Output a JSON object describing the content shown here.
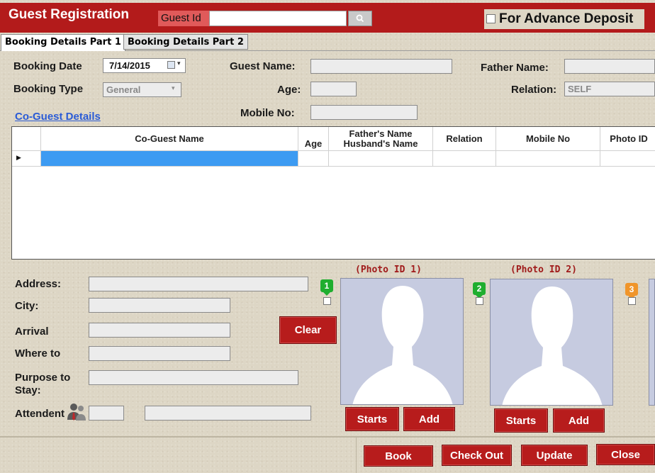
{
  "header": {
    "title": "Guest Registration",
    "guest_id_label": "Guest Id",
    "guest_id_value": "",
    "search_icon": "search-icon",
    "advance_deposit_label": "For Advance Deposit"
  },
  "tabs": [
    {
      "label": "Booking Details Part 1"
    },
    {
      "label": "Booking Details Part 2"
    }
  ],
  "form": {
    "booking_date_label": "Booking Date",
    "booking_date_value": "7/14/2015",
    "booking_type_label": "Booking Type",
    "booking_type_value": "General",
    "guest_name_label": "Guest Name:",
    "age_label": "Age:",
    "mobile_label": "Mobile No:",
    "father_name_label": "Father Name:",
    "relation_label": "Relation:",
    "relation_value": "SELF"
  },
  "co_guest": {
    "link_label": "Co-Guest Details",
    "columns": [
      "Co-Guest Name",
      "Age",
      "Father's Name Husband's Name",
      "Relation",
      "Mobile No",
      "Photo ID"
    ]
  },
  "address": {
    "address_label": "Address:",
    "city_label": "City:",
    "arrival_label": "Arrival",
    "where_label": "Where to",
    "purpose_label": "Purpose to Stay:",
    "attendent_label": "Attendent",
    "clear_label": "Clear"
  },
  "photos": [
    {
      "title": "(Photo ID 1)",
      "badge": "1",
      "badge_color": "#1fae2f",
      "starts_label": "Starts",
      "add_label": "Add"
    },
    {
      "title": "(Photo ID 2)",
      "badge": "2",
      "badge_color": "#1fae2f",
      "starts_label": "Starts",
      "add_label": "Add"
    },
    {
      "badge": "3",
      "badge_color": "#f0952a"
    }
  ],
  "actions": {
    "book": "Book",
    "checkout": "Check Out",
    "update": "Update",
    "close": "Close"
  },
  "colors": {
    "accent": "#b31b1b",
    "link": "#2a5bd6",
    "photo_bg": "#c6cbe0"
  }
}
